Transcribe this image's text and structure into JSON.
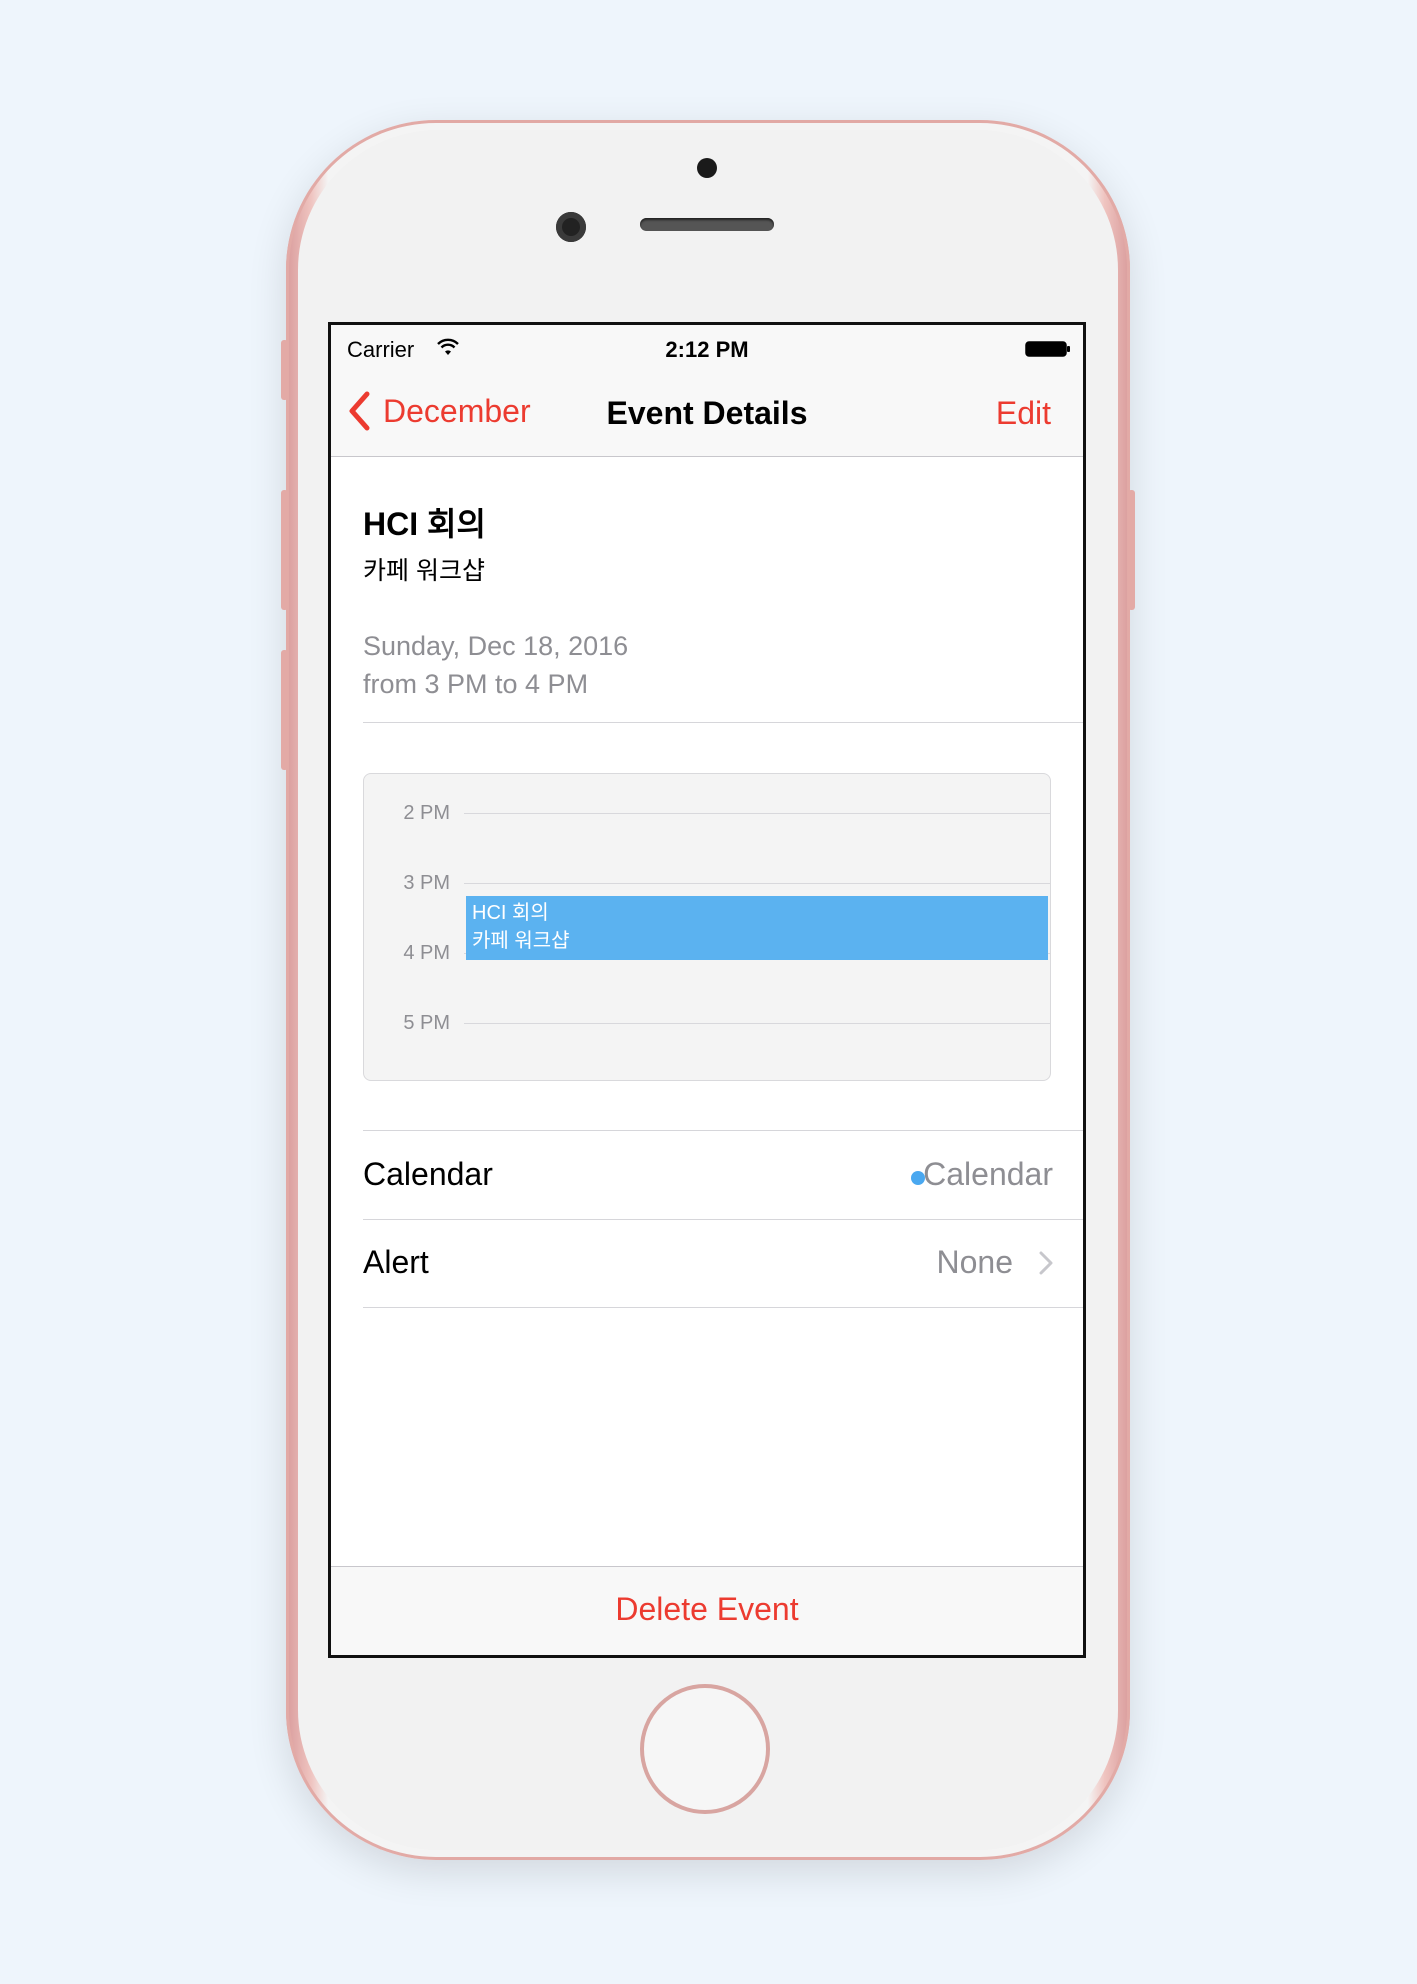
{
  "status_bar": {
    "carrier": "Carrier",
    "time": "2:12 PM"
  },
  "nav_bar": {
    "back_label": "December",
    "title": "Event Details",
    "edit_label": "Edit"
  },
  "event": {
    "title": "HCI 회의",
    "location": "카페 워크샵",
    "date": "Sunday, Dec 18, 2016",
    "time_range": "from 3 PM to 4 PM"
  },
  "day_view": {
    "hours": [
      "2 PM",
      "3 PM",
      "4 PM",
      "5 PM"
    ],
    "block_title": "HCI 회의",
    "block_location": "카페 워크샵"
  },
  "details": [
    {
      "label": "Calendar",
      "value": "Calendar"
    },
    {
      "label": "Alert",
      "value": "None"
    }
  ],
  "actions": {
    "delete_label": "Delete Event"
  },
  "colors": {
    "accent": "#ec3b30",
    "event_blue": "#5bb2f0",
    "calendar_dot": "#4aa8f0"
  },
  "icons": {
    "back": "chevron-left-icon",
    "wifi": "wifi-icon",
    "battery": "battery-icon",
    "disclosure": "chevron-right-icon"
  }
}
